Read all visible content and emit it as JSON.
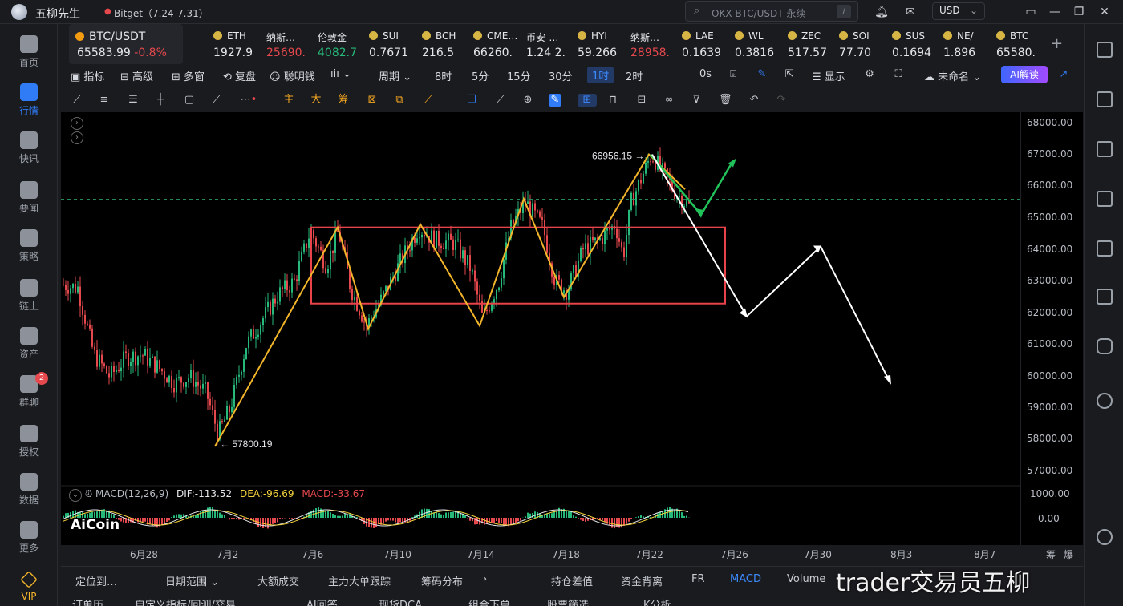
{
  "titlebar": {
    "app_name": "五柳先生",
    "tab_name": "Bitget（7.24-7.31）",
    "search_placeholder": "OKX BTC/USDT 永续",
    "search_shortcut": "/",
    "currency": "USD"
  },
  "leftnav": [
    {
      "label": "首页",
      "icon": "home-icon"
    },
    {
      "label": "行情",
      "icon": "market-icon",
      "active": true
    },
    {
      "label": "快讯",
      "icon": "news-flash-icon"
    },
    {
      "label": "要闻",
      "icon": "headline-icon"
    },
    {
      "label": "策略",
      "icon": "robot-icon"
    },
    {
      "label": "链上",
      "icon": "chain-icon"
    },
    {
      "label": "资产",
      "icon": "wallet-icon"
    },
    {
      "label": "群聊",
      "icon": "chat-icon",
      "badge": "2"
    },
    {
      "label": "授权",
      "icon": "key-icon"
    },
    {
      "label": "数据",
      "icon": "data-icon"
    },
    {
      "label": "更多",
      "icon": "more-icon"
    },
    {
      "label": "VIP",
      "icon": "vip-icon"
    }
  ],
  "tickers": [
    {
      "name": "BTC/USDT",
      "price": "65583.99",
      "change": "-0.8%",
      "selected": true
    },
    {
      "name": "ETH",
      "price": "1927.9",
      "color": "#e5e7eb"
    },
    {
      "name": "纳斯…",
      "price": "25690.",
      "color": "#e5484d"
    },
    {
      "name": "伦敦金",
      "price": "4082.7",
      "color": "#26b97a"
    },
    {
      "name": "SUI",
      "price": "0.7671",
      "color": "#e5e7eb"
    },
    {
      "name": "BCH",
      "price": "216.5",
      "color": "#e5e7eb"
    },
    {
      "name": "CME…",
      "price": "66260.",
      "color": "#e5e7eb"
    },
    {
      "name": "币安-…",
      "price": "1.24 2.",
      "color": "#e5e7eb"
    },
    {
      "name": "HYI",
      "price": "59.266",
      "color": "#e5e7eb"
    },
    {
      "name": "纳斯…",
      "price": "28958.",
      "color": "#e5484d"
    },
    {
      "name": "LAE",
      "price": "0.1639",
      "color": "#e5e7eb"
    },
    {
      "name": "WL",
      "price": "0.3816",
      "color": "#e5e7eb"
    },
    {
      "name": "ZEC",
      "price": "517.57",
      "color": "#e5e7eb"
    },
    {
      "name": "SOI",
      "price": "77.70",
      "color": "#e5e7eb"
    },
    {
      "name": "SUS",
      "price": "0.1694",
      "color": "#e5e7eb"
    },
    {
      "name": "NE/",
      "price": "1.896",
      "color": "#e5e7eb"
    },
    {
      "name": "BTC",
      "price": "65580.",
      "color": "#e5e7eb"
    }
  ],
  "toolbar": {
    "indicator": "指标",
    "advanced": "高级",
    "multi_window": "多窗",
    "replay": "复盘",
    "smart_money": "聪明钱",
    "period": "周期",
    "intervals": [
      "8时",
      "5分",
      "15分",
      "30分",
      "1时",
      "2时"
    ],
    "active_interval": "1时",
    "countdown": "0s",
    "display": "显示",
    "unnamed": "未命名",
    "ai_read": "AI解读"
  },
  "drawtools": {
    "main": "主",
    "big": "大",
    "chips": "筹"
  },
  "price_axis": [
    "68000.00",
    "67000.00",
    "66000.00",
    "65000.00",
    "64000.00",
    "63000.00",
    "62000.00",
    "61000.00",
    "60000.00",
    "59000.00",
    "58000.00",
    "57000.00"
  ],
  "macd_axis": [
    "1000.00",
    "0.00"
  ],
  "time_axis": [
    "6月28",
    "7月2",
    "7月6",
    "7月10",
    "7月14",
    "7月18",
    "7月22",
    "7月26",
    "7月30",
    "8月3",
    "8月7"
  ],
  "axis_right_labels": [
    "筹",
    "爆"
  ],
  "chart_labels": {
    "high": "66956.15",
    "low": "57800.19"
  },
  "macd": {
    "name": "MACD(12,26,9)",
    "dif": "DIF:-113.52",
    "dea": "DEA:-96.69",
    "macd": "MACD:-33.67"
  },
  "bottom_tabs": [
    "定位到…",
    "日期范围",
    "大额成交",
    "主力大单跟踪",
    "筹码分布",
    "持仓差值",
    "资金背离",
    "FR",
    "MACD",
    "Volume"
  ],
  "bottom_active": "MACD",
  "bottom_row2": [
    "订单历…",
    "自定义指标/回测/交易",
    "AI回答",
    "现货DCA",
    "组合下单",
    "股票筛选",
    "K分析"
  ],
  "watermark": "trader交易员五柳",
  "logo_text": "AiCoin",
  "colors": {
    "accent": "#2f7cf6",
    "up": "#26b97a",
    "down": "#e5484d",
    "yellow_wave": "#f3b52a",
    "box_red": "#e8434a",
    "projection_white": "#ffffff",
    "projection_green": "#22c25a"
  }
}
